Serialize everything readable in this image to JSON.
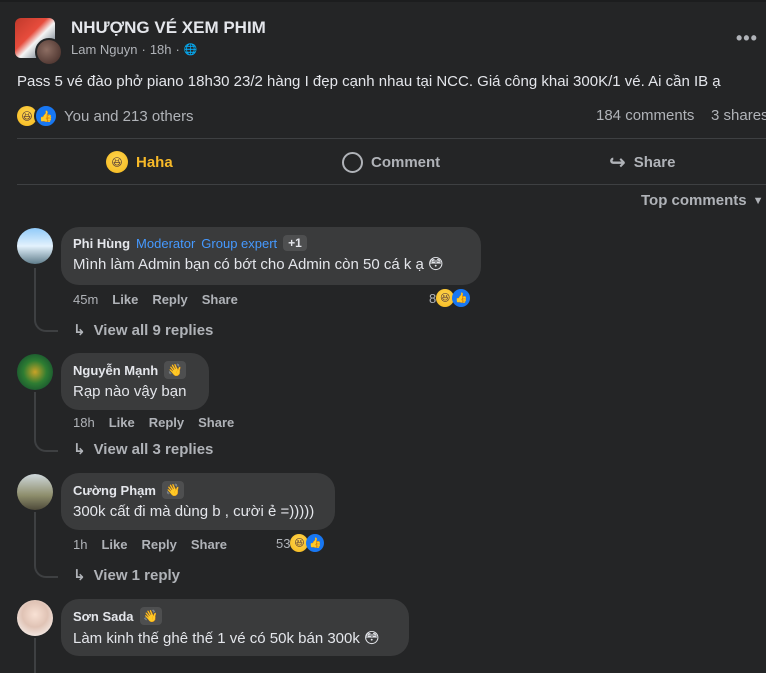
{
  "post": {
    "group_name": "NHƯỢNG VÉ XEM PHIM",
    "author": "Lam Nguyn",
    "time": "18h",
    "text": "Pass 5 vé đào phở piano 18h30 23/2 hàng I đẹp cạnh nhau tại NCC. Giá công khai 300K/1 vé. Ai cần IB ạ",
    "reactions_text": "You and 213 others",
    "comments_count": "184 comments",
    "shares_count": "3 shares"
  },
  "actions": {
    "haha": "Haha",
    "comment": "Comment",
    "share": "Share"
  },
  "sort_label": "Top comments",
  "comments": [
    {
      "name": "Phi Hùng",
      "badge1": "Moderator",
      "badge2": "Group expert",
      "badge3": "+1",
      "text": "Mình làm Admin bạn có bớt cho Admin còn 50 cá k ạ 😳",
      "time": "45m",
      "like": "Like",
      "reply": "Reply",
      "share": "Share",
      "reactions": "8",
      "view_replies": "View all 9 replies"
    },
    {
      "name": "Nguyễn Mạnh",
      "text": "Rạp nào vậy bạn",
      "time": "18h",
      "like": "Like",
      "reply": "Reply",
      "share": "Share",
      "view_replies": "View all 3 replies"
    },
    {
      "name": "Cường Phạm",
      "text": "300k cất đi mà dùng b , cười ẻ =)))))",
      "time": "1h",
      "like": "Like",
      "reply": "Reply",
      "share": "Share",
      "reactions": "53",
      "view_replies": "View 1 reply"
    },
    {
      "name": "Sơn Sada",
      "text": "Làm kinh thế ghê thế 1 vé có 50k bán 300k 😳"
    }
  ],
  "icons": {
    "globe": "🌐",
    "more": "•••",
    "haha": "😆",
    "like": "👍",
    "comment": "○",
    "share": "↪",
    "caret": "▼",
    "reply_arrow": "↳",
    "wave": "👋"
  }
}
